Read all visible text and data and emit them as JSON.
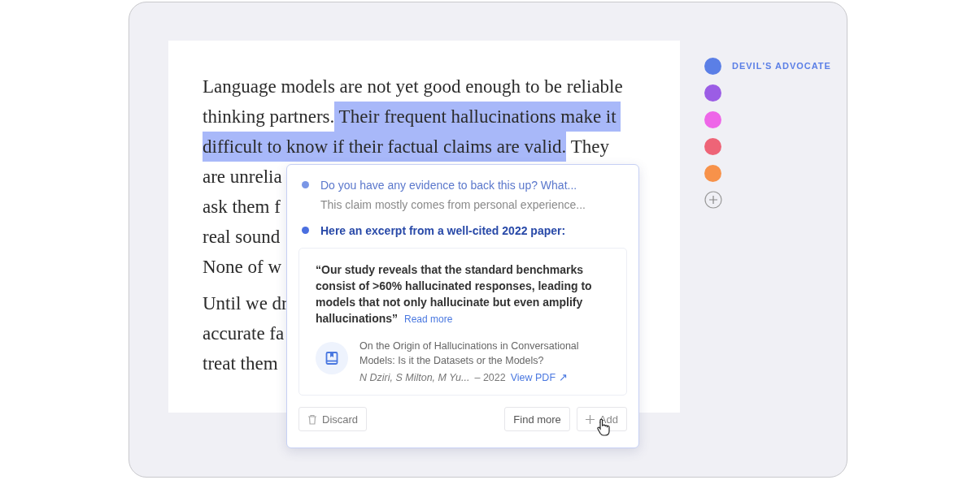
{
  "document": {
    "paragraphs": [
      {
        "lines": [
          {
            "segments": [
              {
                "text": "Language models are not yet good enough to be reliable",
                "highlighted": false
              }
            ]
          },
          {
            "segments": [
              {
                "text": "thinking partners.",
                "highlighted": false
              },
              {
                "text": " Their frequent hallucinations make it ",
                "highlighted": true
              }
            ]
          },
          {
            "segments": [
              {
                "text": "difficult to know if their factual claims are valid.",
                "highlighted": true
              },
              {
                "text": " They",
                "highlighted": false
              }
            ]
          },
          {
            "segments": [
              {
                "text": "are unrelia",
                "highlighted": false
              }
            ]
          },
          {
            "segments": [
              {
                "text": "ask them f",
                "highlighted": false
              }
            ]
          },
          {
            "segments": [
              {
                "text": "real sound",
                "highlighted": false
              }
            ]
          },
          {
            "segments": [
              {
                "text": "None of w",
                "highlighted": false
              }
            ]
          }
        ]
      },
      {
        "lines": [
          {
            "segments": [
              {
                "text": "Until we dr",
                "highlighted": false
              }
            ]
          },
          {
            "segments": [
              {
                "text": "accurate fa",
                "highlighted": false
              }
            ]
          },
          {
            "segments": [
              {
                "text": "treat them",
                "highlighted": false
              }
            ]
          }
        ]
      }
    ]
  },
  "personas": [
    {
      "color": "#5b7fe6",
      "label": "DEVIL'S ADVOCATE"
    },
    {
      "color": "#9b5de5"
    },
    {
      "color": "#ee66e8"
    },
    {
      "color": "#ee6477"
    },
    {
      "color": "#f7924a"
    }
  ],
  "popup": {
    "thread": [
      {
        "kind": "question",
        "text": "Do you have any evidence to back this up? What...",
        "reply": "This claim mostly comes from personal experience..."
      },
      {
        "kind": "answer",
        "text": "Here an excerpt from a well-cited 2022 paper:"
      }
    ],
    "excerpt": {
      "quote": "“Our study reveals that the standard benchmarks consist of >60% hallucinated responses, leading to models that not only hallucinate but even amplify hallucinations”",
      "read_more": "Read more",
      "source": {
        "title": "On the Origin of Hallucinations in Conversational Models: Is it the Datasets or the Models?",
        "authors": "N Dziri, S Milton, M Yu...",
        "year": "– 2022",
        "link": "View PDF ↗"
      }
    },
    "buttons": [
      {
        "kind": "discard",
        "label": "Discard"
      },
      {
        "kind": "find",
        "label": "Find more"
      },
      {
        "kind": "add",
        "label": "Add"
      }
    ]
  }
}
